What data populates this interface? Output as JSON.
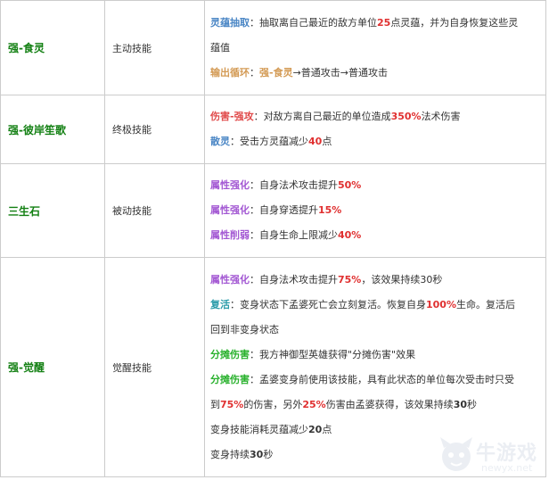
{
  "rows": [
    {
      "name": "强-食灵",
      "type": "主动技能",
      "lines": [
        [
          {
            "t": "灵蕴抽取",
            "c": "lbl lbl-blue"
          },
          {
            "t": "：抽取离自己最近的敌方单位",
            "c": "plain"
          },
          {
            "t": "25",
            "c": "em-red"
          },
          {
            "t": "点灵蕴，并为自身恢复这些灵",
            "c": "plain"
          }
        ],
        [
          {
            "t": "蕴值",
            "c": "plain"
          }
        ],
        [
          {
            "t": "输出循环",
            "c": "lbl lbl-orange"
          },
          {
            "t": "：",
            "c": "plain"
          },
          {
            "t": "强-食灵",
            "c": "em-orange"
          },
          {
            "t": "→普通攻击→普通攻击",
            "c": "plain"
          }
        ]
      ]
    },
    {
      "name": "强-彼岸笙歌",
      "type": "终极技能",
      "lines": [
        [
          {
            "t": "伤害-强攻",
            "c": "lbl lbl-red"
          },
          {
            "t": "：对敌方离自己最近的单位造成",
            "c": "plain"
          },
          {
            "t": "350%",
            "c": "em-red"
          },
          {
            "t": "法术伤害",
            "c": "plain"
          }
        ],
        [
          {
            "t": "散灵",
            "c": "lbl lbl-blue"
          },
          {
            "t": "：受击方灵蕴减少",
            "c": "plain"
          },
          {
            "t": "40",
            "c": "em-red"
          },
          {
            "t": "点",
            "c": "plain"
          }
        ]
      ]
    },
    {
      "name": "三生石",
      "type": "被动技能",
      "lines": [
        [
          {
            "t": "属性强化",
            "c": "lbl lbl-purple"
          },
          {
            "t": "：自身法术攻击提升",
            "c": "plain"
          },
          {
            "t": "50%",
            "c": "em-red"
          }
        ],
        [
          {
            "t": "属性强化",
            "c": "lbl lbl-purple"
          },
          {
            "t": "：自身穿透提升",
            "c": "plain"
          },
          {
            "t": "15%",
            "c": "em-red"
          }
        ],
        [
          {
            "t": "属性削弱",
            "c": "lbl lbl-purple"
          },
          {
            "t": "：自身生命上限减少",
            "c": "plain"
          },
          {
            "t": "40%",
            "c": "em-red"
          }
        ]
      ]
    },
    {
      "name": "强-觉醒",
      "type": "觉醒技能",
      "lines": [
        [
          {
            "t": "属性强化",
            "c": "lbl lbl-purple"
          },
          {
            "t": "：自身法术攻击提升",
            "c": "plain"
          },
          {
            "t": "75%",
            "c": "em-red"
          },
          {
            "t": "，该效果持续30秒",
            "c": "plain"
          }
        ],
        [
          {
            "t": "复活",
            "c": "lbl lbl-teal"
          },
          {
            "t": "：变身状态下孟婆死亡会立刻复活。恢复自身",
            "c": "plain"
          },
          {
            "t": "100%",
            "c": "em-red"
          },
          {
            "t": "生命。复活后",
            "c": "plain"
          }
        ],
        [
          {
            "t": "回到非变身状态",
            "c": "plain"
          }
        ],
        [
          {
            "t": "分摊伤害",
            "c": "lbl lbl-green"
          },
          {
            "t": "：我方神御型英雄获得\"分摊伤害\"效果",
            "c": "plain"
          }
        ],
        [
          {
            "t": "分摊伤害",
            "c": "lbl lbl-green"
          },
          {
            "t": "：孟婆变身前使用该技能，具有此状态的单位每次受击时只受",
            "c": "plain"
          }
        ],
        [
          {
            "t": "到",
            "c": "plain"
          },
          {
            "t": "75%",
            "c": "em-red"
          },
          {
            "t": "的伤害，另外",
            "c": "plain"
          },
          {
            "t": "25%",
            "c": "em-red"
          },
          {
            "t": "伤害由孟婆获得，该效果持续",
            "c": "plain"
          },
          {
            "t": "30",
            "c": "em-bold"
          },
          {
            "t": "秒",
            "c": "plain"
          }
        ],
        [
          {
            "t": "变身技能消耗灵蕴减少",
            "c": "plain"
          },
          {
            "t": "20",
            "c": "em-bold"
          },
          {
            "t": "点",
            "c": "plain"
          }
        ],
        [
          {
            "t": "变身持续",
            "c": "plain"
          },
          {
            "t": "30",
            "c": "em-bold"
          },
          {
            "t": "秒",
            "c": "plain"
          }
        ]
      ]
    }
  ],
  "watermark": {
    "logo_icon": "cartoon-mascot-icon",
    "text": "牛游戏",
    "url": "newyx.net"
  }
}
